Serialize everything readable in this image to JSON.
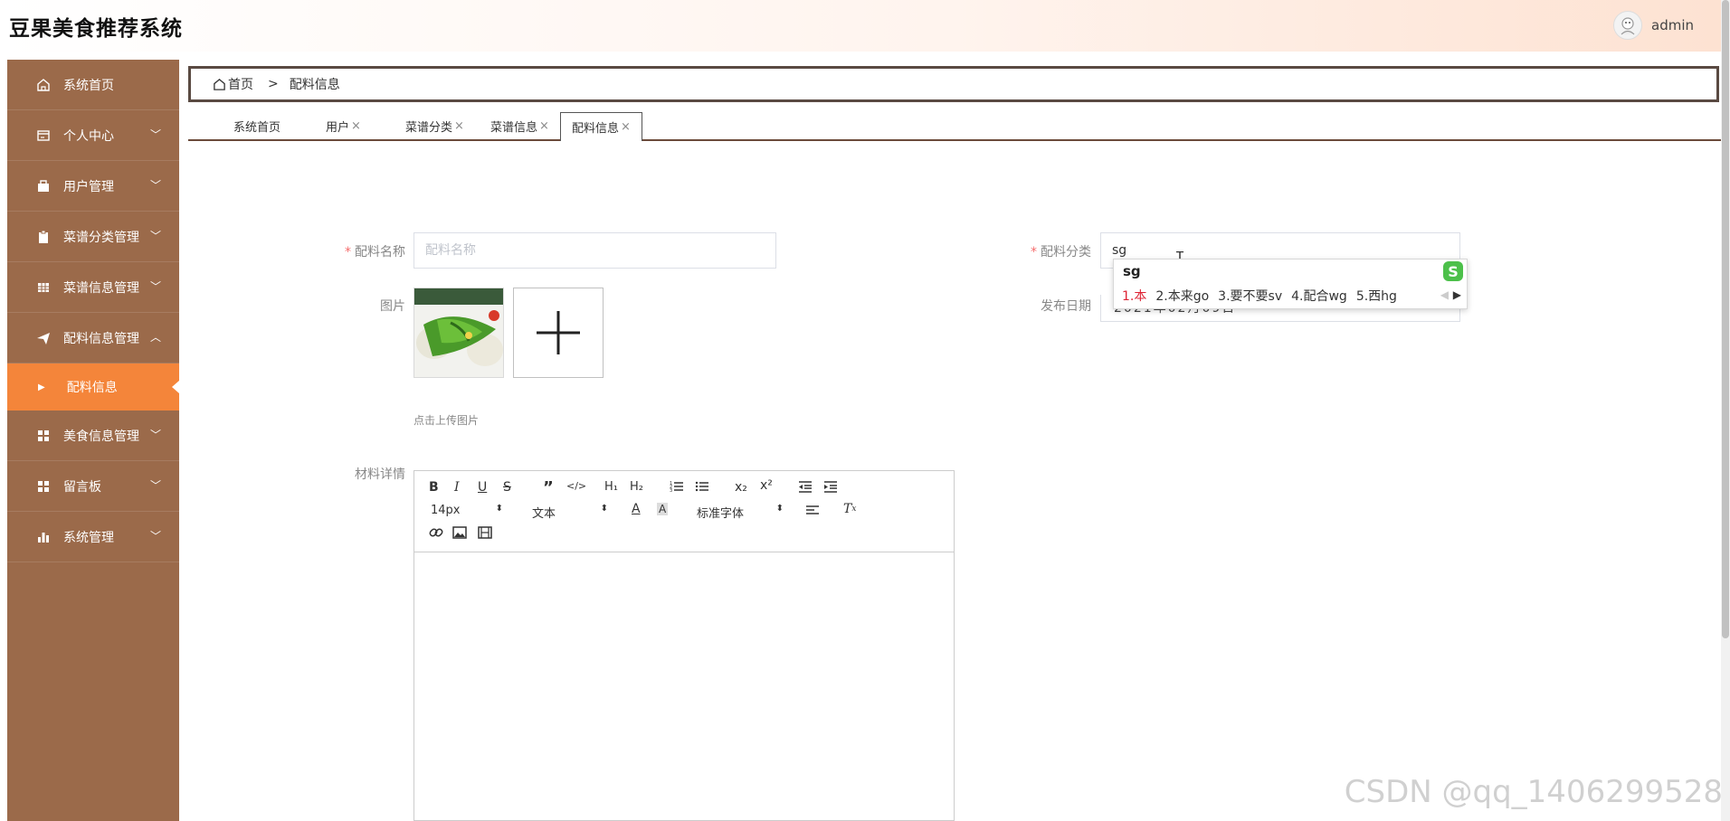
{
  "header": {
    "app_title": "豆果美食推荐系统",
    "user_name": "admin"
  },
  "sidebar": {
    "items": [
      {
        "label": "系统首页",
        "icon": "home-icon"
      },
      {
        "label": "个人中心",
        "icon": "card-icon"
      },
      {
        "label": "用户管理",
        "icon": "briefcase-icon"
      },
      {
        "label": "菜谱分类管理",
        "icon": "clipboard-icon"
      },
      {
        "label": "菜谱信息管理",
        "icon": "grid-icon"
      },
      {
        "label": "配料信息管理",
        "icon": "send-icon"
      },
      {
        "label": "美食信息管理",
        "icon": "apps-icon"
      },
      {
        "label": "留言板",
        "icon": "apps-icon"
      },
      {
        "label": "系统管理",
        "icon": "bar-chart-icon"
      }
    ],
    "active_sub": "配料信息"
  },
  "breadcrumb": {
    "home": "首页",
    "separator": ">",
    "current": "配料信息"
  },
  "tabs": [
    {
      "label": "系统首页",
      "closable": false
    },
    {
      "label": "用户",
      "closable": true
    },
    {
      "label": "菜谱分类",
      "closable": true
    },
    {
      "label": "菜谱信息",
      "closable": true
    },
    {
      "label": "配料信息",
      "closable": true,
      "active": true
    }
  ],
  "form": {
    "name_label": "配料名称",
    "name_placeholder": "配料名称",
    "category_label": "配料分类",
    "category_value": "sg",
    "image_label": "图片",
    "upload_tip": "点击上传图片",
    "date_label": "发布日期",
    "date_value": "2021年02月09日",
    "detail_label": "材料详情"
  },
  "editor": {
    "font_size": "14px",
    "format": "文本",
    "font_family": "标准字体"
  },
  "ime": {
    "composition": "sg",
    "candidates": [
      "1.本",
      "2.本来go",
      "3.要不要sv",
      "4.配合wg",
      "5.西hg"
    ]
  },
  "watermark": "CSDN @qq_1406299528",
  "colors": {
    "sidebar": "#9b6a4a",
    "active": "#f4853a",
    "accent_border": "#5a4a42"
  }
}
